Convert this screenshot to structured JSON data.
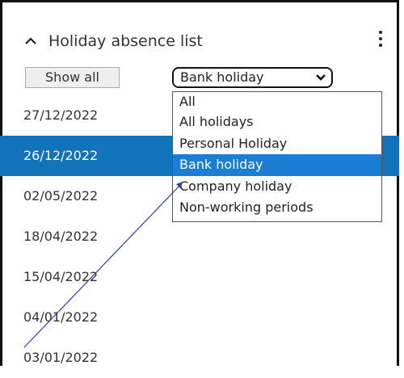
{
  "panel": {
    "title": "Holiday absence list",
    "collapse_icon": "chevron-up-icon",
    "menu_icon": "kebab-menu-icon"
  },
  "toolbar": {
    "show_all_label": "Show all",
    "filter_selected": "Bank holiday",
    "filter_icon": "chevron-down-icon"
  },
  "filter_options": [
    {
      "label": "All",
      "highlighted": false
    },
    {
      "label": "All holidays",
      "highlighted": false
    },
    {
      "label": "Personal Holiday",
      "highlighted": false
    },
    {
      "label": "Bank holiday",
      "highlighted": true
    },
    {
      "label": "Company holiday",
      "highlighted": false
    },
    {
      "label": "Non-working periods",
      "highlighted": false
    }
  ],
  "dates": [
    {
      "date": "27/12/2022",
      "selected": false
    },
    {
      "date": "26/12/2022",
      "selected": true
    },
    {
      "date": "02/05/2022",
      "selected": false
    },
    {
      "date": "18/04/2022",
      "selected": false
    },
    {
      "date": "15/04/2022",
      "selected": false
    },
    {
      "date": "04/01/2022",
      "selected": false
    },
    {
      "date": "03/01/2022",
      "selected": false
    }
  ],
  "colors": {
    "selected_row": "#1373ba",
    "highlighted_option": "#1a7fd4",
    "annotation_arrow": "#2b3fa8"
  }
}
